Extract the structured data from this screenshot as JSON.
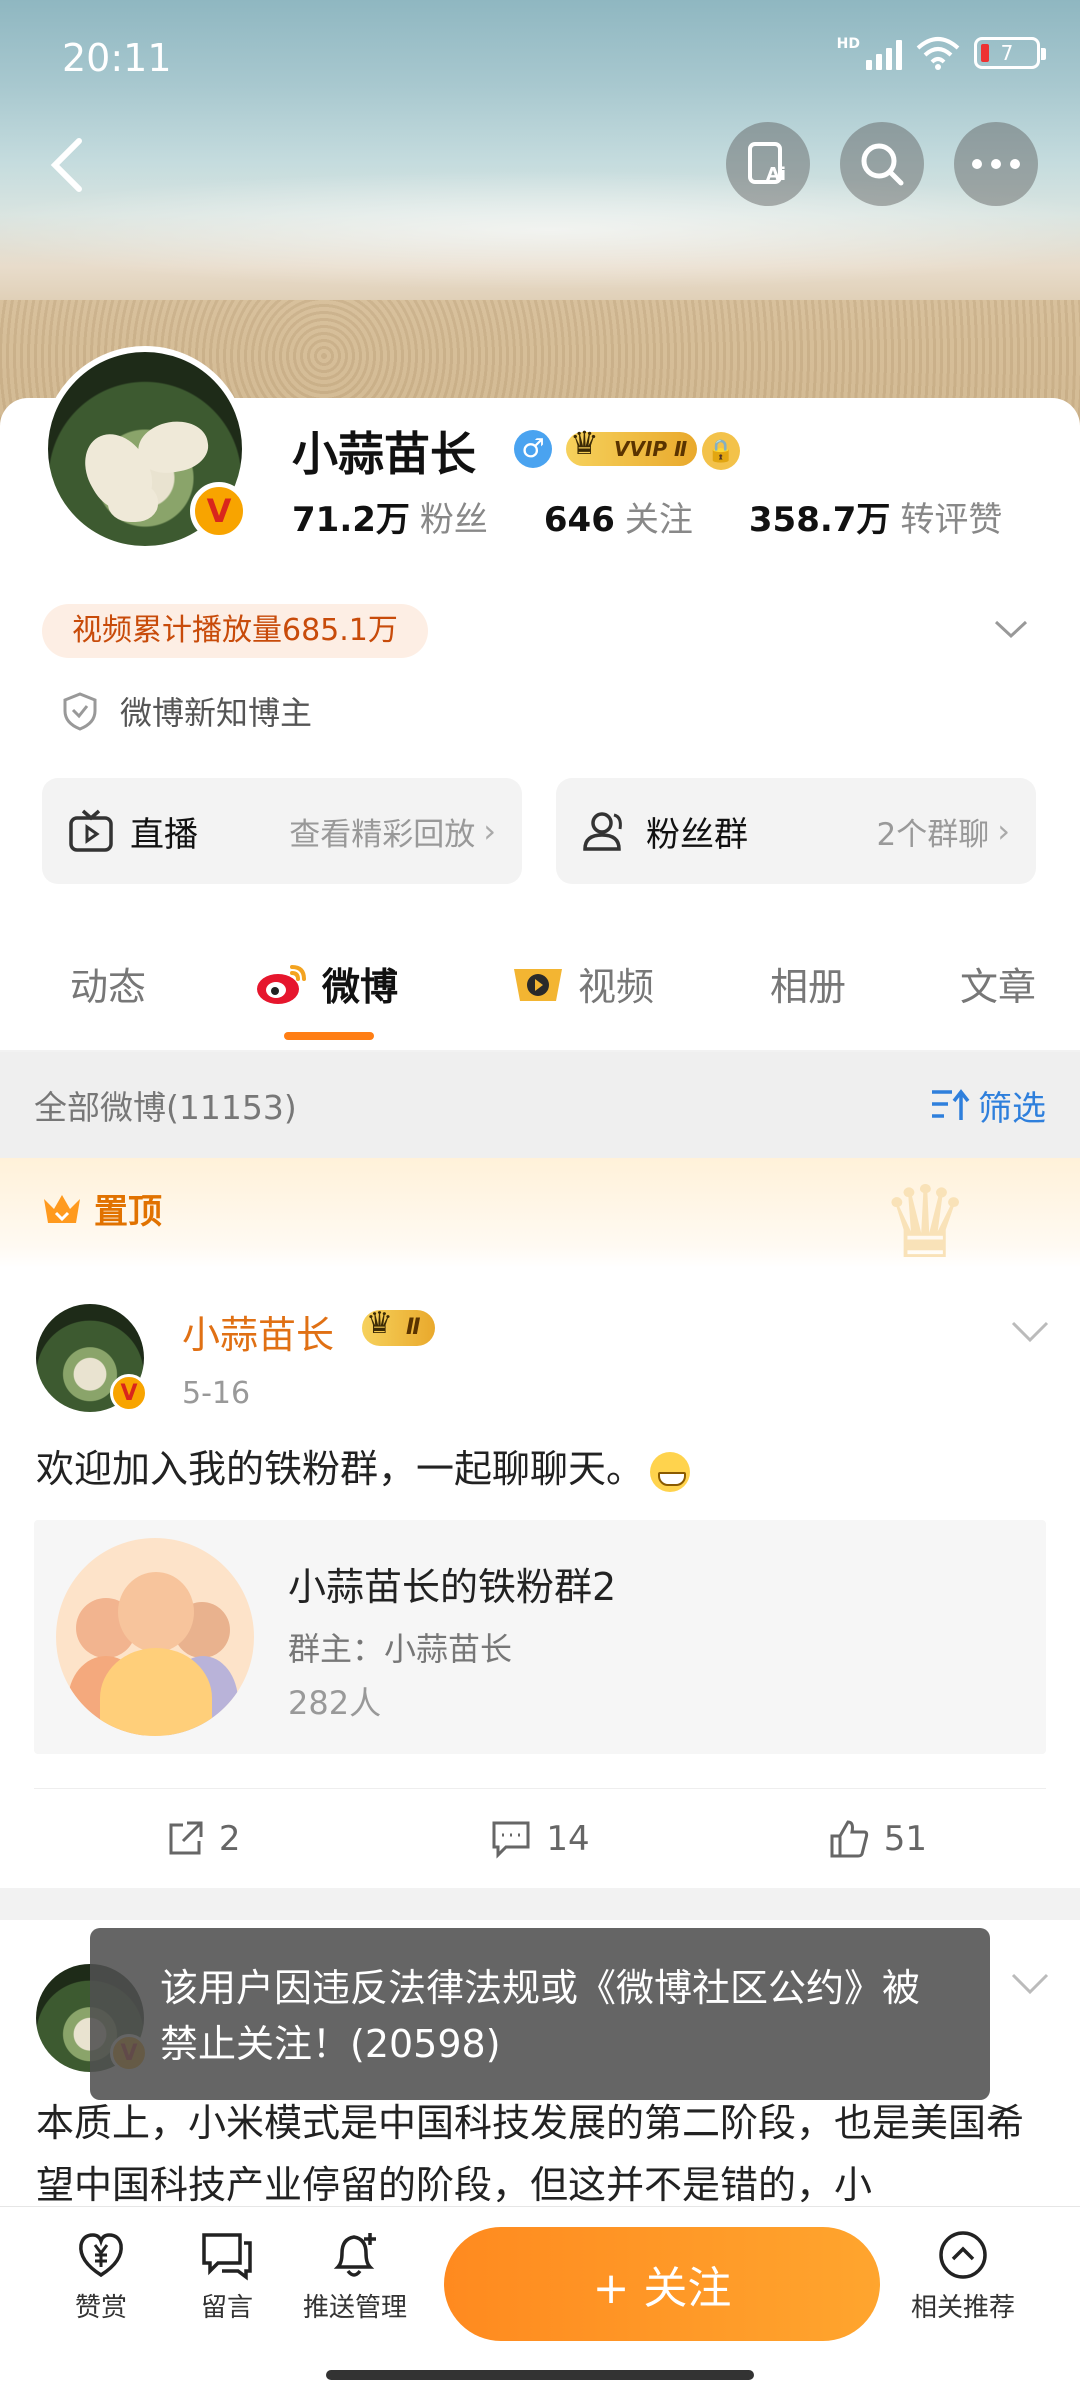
{
  "status": {
    "time": "20:11",
    "network": "HD",
    "battery": "7"
  },
  "profile": {
    "name": "小蒜苗长",
    "vip_label": "VVIP Ⅱ",
    "stats": [
      {
        "value": "71.2万",
        "label": "粉丝"
      },
      {
        "value": "646",
        "label": "关注"
      },
      {
        "value": "358.7万",
        "label": "转评赞"
      }
    ],
    "video_plays": "视频累计播放量685.1万",
    "tag": "微博新知博主"
  },
  "quick": {
    "live": {
      "title": "直播",
      "sub": "查看精彩回放"
    },
    "fans": {
      "title": "粉丝群",
      "sub": "2个群聊"
    }
  },
  "tabs": [
    "动态",
    "微博",
    "视频",
    "相册",
    "文章"
  ],
  "filter": {
    "label": "全部微博(11153)",
    "button": "筛选"
  },
  "pinned_label": "置顶",
  "post": {
    "author": "小蒜苗长",
    "vip_label": "Ⅱ",
    "date": "5-16",
    "text": "欢迎加入我的铁粉群，一起聊聊天。",
    "group": {
      "name": "小蒜苗长的铁粉群2",
      "owner": "群主：小蒜苗长",
      "count": "282人"
    },
    "actions": {
      "repost": "2",
      "comment": "14",
      "like": "51"
    }
  },
  "post2": {
    "text": "本质上，小米模式是中国科技发展的第二阶段，也是美国希望中国科技产业停留的阶段，但这并不是错的，小"
  },
  "toast": "该用户因违反法律法规或《微博社区公约》被禁止关注！(20598)",
  "bottom": {
    "reward": "赞赏",
    "message": "留言",
    "push": "推送管理",
    "follow": "+ 关注",
    "related": "相关推荐"
  }
}
